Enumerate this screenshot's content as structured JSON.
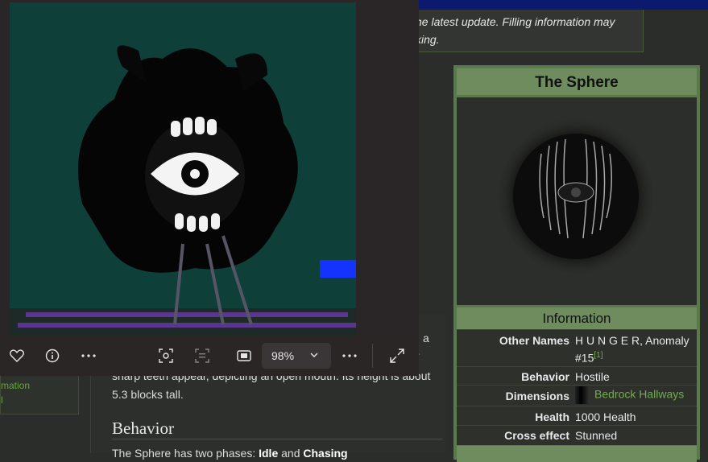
{
  "notice": {
    "line1": "he latest update. Filling information may",
    "line2": "king."
  },
  "left_panel": {
    "link1": "mation",
    "link2": "l"
  },
  "article": {
    "line_a": "a",
    "line_r": "r",
    "line2": "sharp teeth appear, depicting an open mouth. Its height is about",
    "line3": "5.3 blocks tall.",
    "heading": "Behavior",
    "last_prefix": "The Sphere has two phases: ",
    "last_bold1": "Idle",
    "last_mid": " and ",
    "last_bold2": "Chasing"
  },
  "infobox": {
    "title": "The Sphere",
    "section": "Information",
    "rows": [
      {
        "label": "Other Names",
        "value": "H U N G E R, Anomaly",
        "value2": "#15",
        "ref": "[1]"
      },
      {
        "label": "Behavior",
        "value": "Hostile"
      },
      {
        "label": "Dimensions",
        "value": "Bedrock Hallways"
      },
      {
        "label": "Health",
        "value": "1000 Health"
      },
      {
        "label": "Cross effect",
        "value": "Stunned"
      }
    ]
  },
  "viewer": {
    "zoom": "98%",
    "icons": [
      "heart-icon",
      "info-icon",
      "more-icon",
      "screen-capture-icon",
      "text-scan-icon",
      "fit-screen-icon",
      "chevron-down-icon",
      "more-icon",
      "expand-icon"
    ]
  },
  "colors": {
    "link": "#6fb043",
    "infobox_header": "#6e8c5e",
    "topbar": "#0b1a6e"
  }
}
